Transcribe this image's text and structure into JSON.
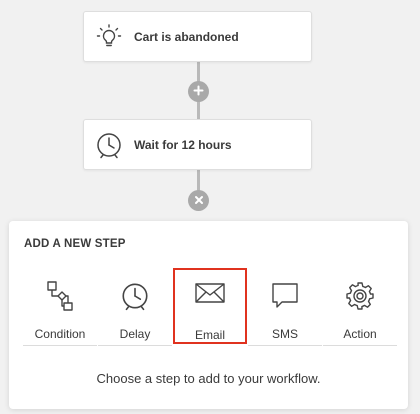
{
  "workflow": {
    "nodes": [
      {
        "label": "Cart is abandoned",
        "icon": "lightbulb-icon"
      },
      {
        "label": "Wait for 12 hours",
        "icon": "clock-icon"
      }
    ],
    "add_button_icon": "plus-icon",
    "close_button_icon": "close-icon"
  },
  "panel": {
    "title": "ADD A NEW STEP",
    "steps": [
      {
        "label": "Condition",
        "icon": "condition-flow-icon"
      },
      {
        "label": "Delay",
        "icon": "clock-icon"
      },
      {
        "label": "Email",
        "icon": "envelope-icon",
        "selected": true
      },
      {
        "label": "SMS",
        "icon": "speech-bubble-icon"
      },
      {
        "label": "Action",
        "icon": "gear-icon"
      }
    ],
    "footer": "Choose a step to add to your workflow."
  },
  "colors": {
    "selected_outline": "#e0321f",
    "connector": "#b9b9b9",
    "background": "#f1f1f1"
  }
}
